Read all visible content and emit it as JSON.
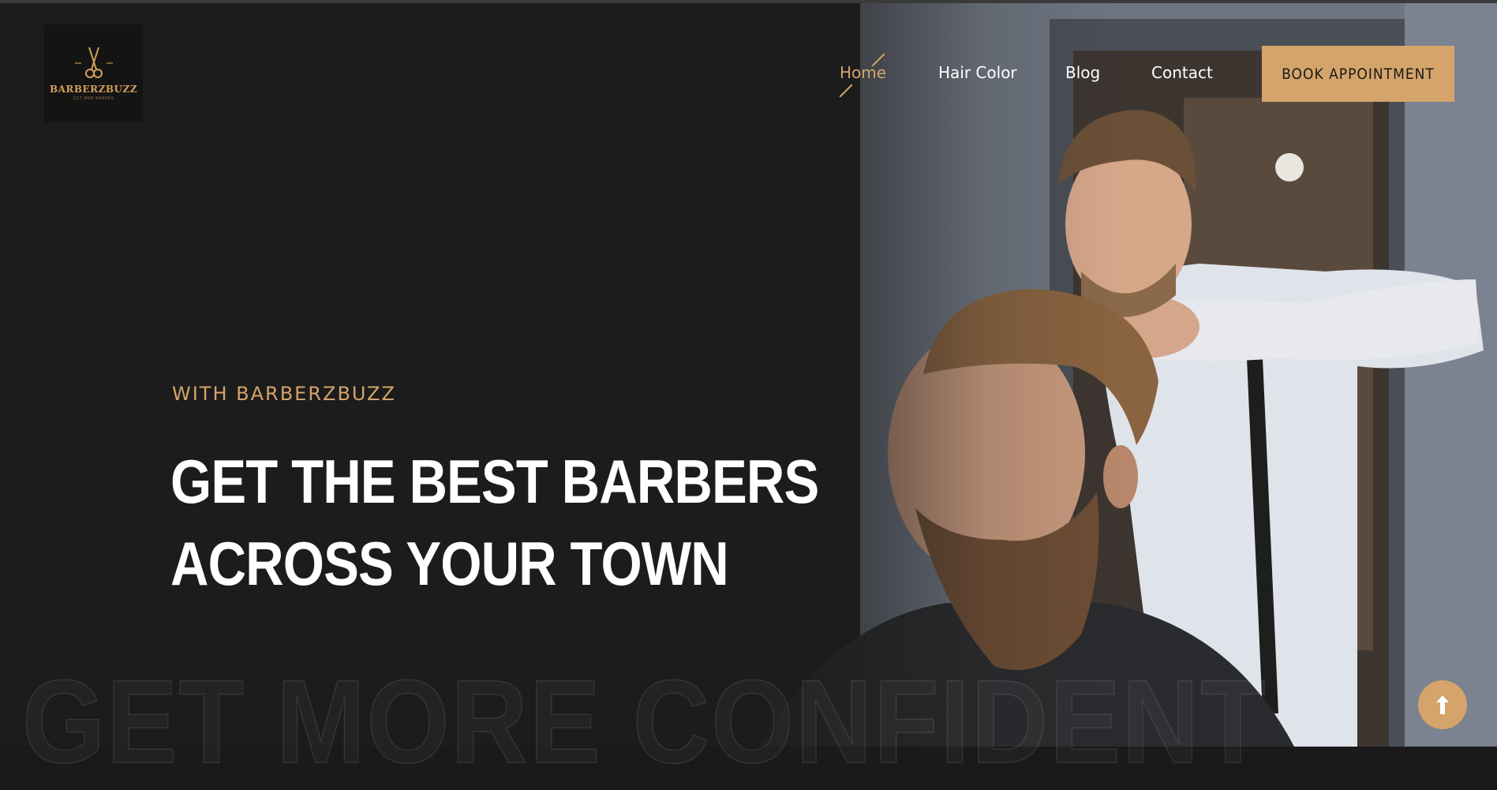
{
  "brand": {
    "name": "BARBERZBUZZ",
    "tagline": "CUT AND SHAVES",
    "color": "#d4a46a"
  },
  "nav": {
    "items": [
      {
        "label": "Home",
        "active": true
      },
      {
        "label": "Hair Color",
        "active": false
      },
      {
        "label": "Blog",
        "active": false
      },
      {
        "label": "Contact",
        "active": false
      }
    ],
    "cta_label": "BOOK APPOINTMENT"
  },
  "hero": {
    "kicker": "WITH BARBERZBUZZ",
    "headline_line1": "GET THE BEST BARBERS",
    "headline_line2": "ACROSS YOUR TOWN",
    "outline_text": "GET MORE CONFIDENT",
    "image_subject": "barber-styling-bearded-client"
  },
  "scroll_top_icon": "arrow-up-icon",
  "colors": {
    "background": "#1c1c1c",
    "accent": "#d4a46a",
    "text": "#ffffff"
  }
}
